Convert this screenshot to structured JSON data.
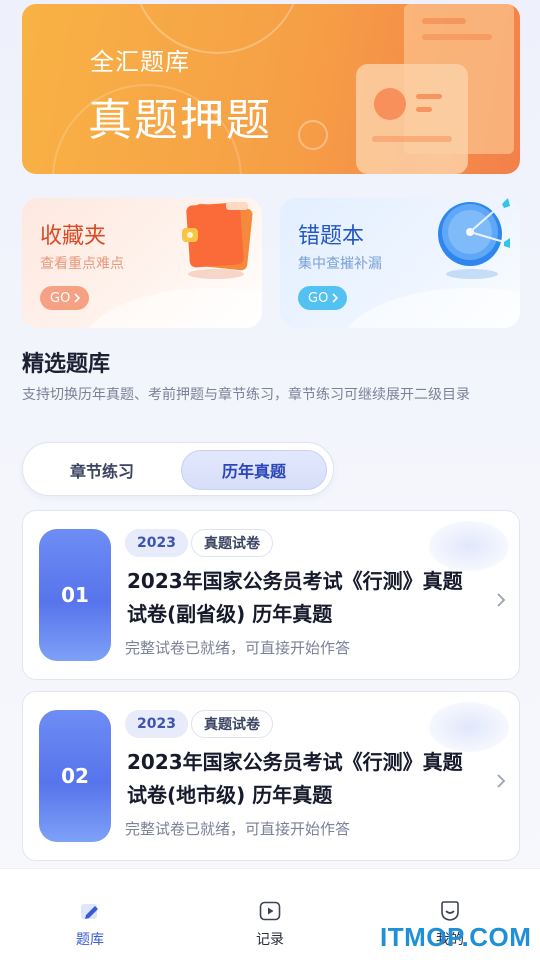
{
  "banner": {
    "subtitle": "全汇题库",
    "title": "真题押题"
  },
  "quick_cards": [
    {
      "title": "收藏夹",
      "desc": "查看重点难点",
      "go_label": "GO",
      "icon": "folder-bookmark-icon",
      "accent": "#d94b25"
    },
    {
      "title": "错题本",
      "desc": "集中查摧补漏",
      "go_label": "GO",
      "icon": "target-dart-icon",
      "accent": "#2557c7"
    }
  ],
  "section": {
    "title": "精选题库",
    "desc": "支持切换历年真题、考前押题与章节练习，章节练习可继续展开二级目录"
  },
  "segments": {
    "options": [
      "章节练习",
      "历年真题"
    ],
    "selected": "历年真题"
  },
  "papers": [
    {
      "index": "01",
      "year_tag": "2023",
      "kind_tag": "真题试卷",
      "title": "2023年国家公务员考试《行测》真题试卷(副省级) 历年真题",
      "status": "完整试卷已就绪，可直接开始作答"
    },
    {
      "index": "02",
      "year_tag": "2023",
      "kind_tag": "真题试卷",
      "title": "2023年国家公务员考试《行测》真题试卷(地市级) 历年真题",
      "status": "完整试卷已就绪，可直接开始作答"
    }
  ],
  "tabbar": {
    "items": [
      {
        "label": "题库",
        "icon": "pencil-book-icon",
        "active": true
      },
      {
        "label": "记录",
        "icon": "play-record-icon",
        "active": false
      },
      {
        "label": "我的",
        "icon": "profile-icon",
        "active": false
      }
    ]
  },
  "watermark": "ITMOP.COM",
  "colors": {
    "primary": "#3a5bd7",
    "banner_orange": "#f69f46",
    "badge_blue": "#5774ec"
  }
}
